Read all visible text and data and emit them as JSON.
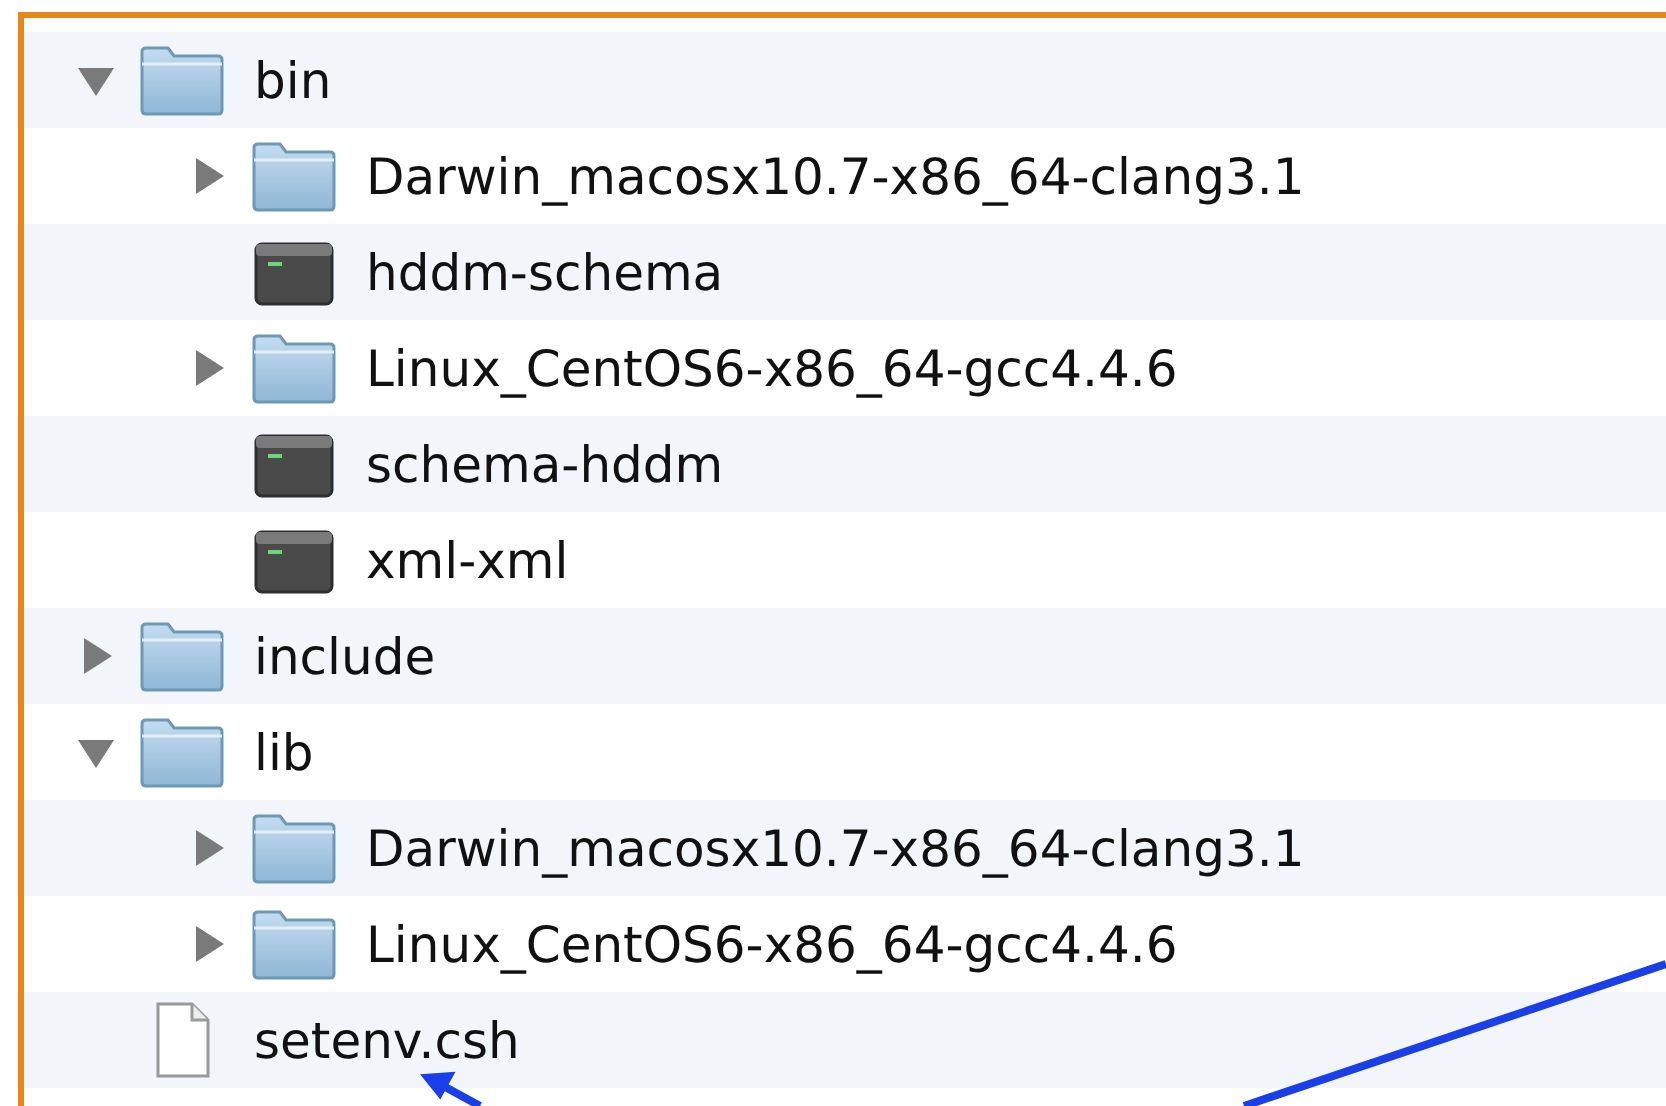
{
  "tree": [
    {
      "name": "bin",
      "kind": "folder",
      "expanded": true,
      "children": [
        {
          "name": "Darwin_macosx10.7-x86_64-clang3.1",
          "kind": "folder",
          "expanded": false
        },
        {
          "name": "hddm-schema",
          "kind": "executable"
        },
        {
          "name": "Linux_CentOS6-x86_64-gcc4.4.6",
          "kind": "folder",
          "expanded": false
        },
        {
          "name": "schema-hddm",
          "kind": "executable"
        },
        {
          "name": "xml-xml",
          "kind": "executable"
        }
      ]
    },
    {
      "name": "include",
      "kind": "folder",
      "expanded": false
    },
    {
      "name": "lib",
      "kind": "folder",
      "expanded": true,
      "children": [
        {
          "name": "Darwin_macosx10.7-x86_64-clang3.1",
          "kind": "folder",
          "expanded": false
        },
        {
          "name": "Linux_CentOS6-x86_64-gcc4.4.6",
          "kind": "folder",
          "expanded": false
        }
      ]
    },
    {
      "name": "setenv.csh",
      "kind": "file"
    }
  ]
}
